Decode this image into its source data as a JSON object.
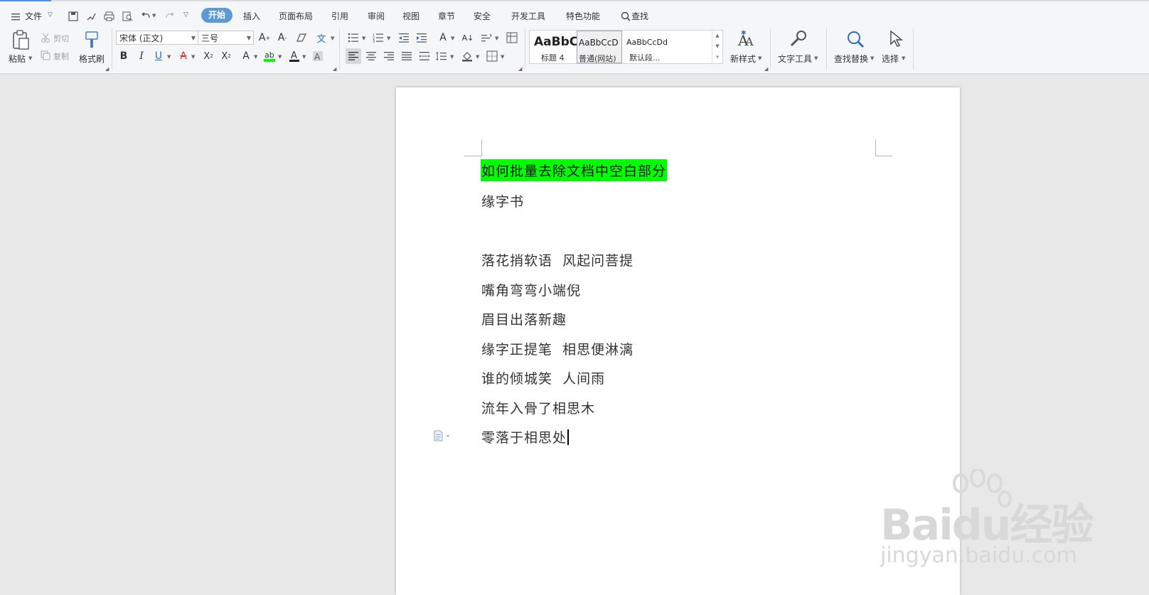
{
  "menu": {
    "file": "文件",
    "tabs": [
      "开始",
      "插入",
      "页面布局",
      "引用",
      "审阅",
      "视图",
      "章节",
      "安全",
      "开发工具",
      "特色功能"
    ],
    "active_tab": "开始",
    "search": "查找"
  },
  "ribbon": {
    "paste": "粘贴",
    "cut": "剪切",
    "copy": "复制",
    "format_painter": "格式刷",
    "font_name": "宋体 (正文)",
    "font_size": "三号",
    "styles": [
      {
        "sample": "AaBbC",
        "name": "标题 4"
      },
      {
        "sample": "AaBbCcD",
        "name": "普通(网站)"
      },
      {
        "sample": "AaBbCcDd",
        "name": "默认段..."
      }
    ],
    "new_style": "新样式",
    "text_tools": "文字工具",
    "find_replace": "查找替换",
    "select": "选择"
  },
  "document": {
    "title": "如何批量去除文档中空白部分",
    "lines": [
      "缘字书",
      "",
      "落花捎软语  风起问菩提",
      "嘴角弯弯小端倪",
      "眉目出落新趣",
      "缘字正提笔  相思便淋漓",
      "谁的倾城笑  人间雨",
      "流年入骨了相思木",
      "零落于相思处"
    ]
  },
  "watermark": {
    "logo": "Baidu经验",
    "url": "jingyan.baidu.com"
  },
  "colors": {
    "accent": "#5b9bd5",
    "highlight": "#00ff00"
  }
}
